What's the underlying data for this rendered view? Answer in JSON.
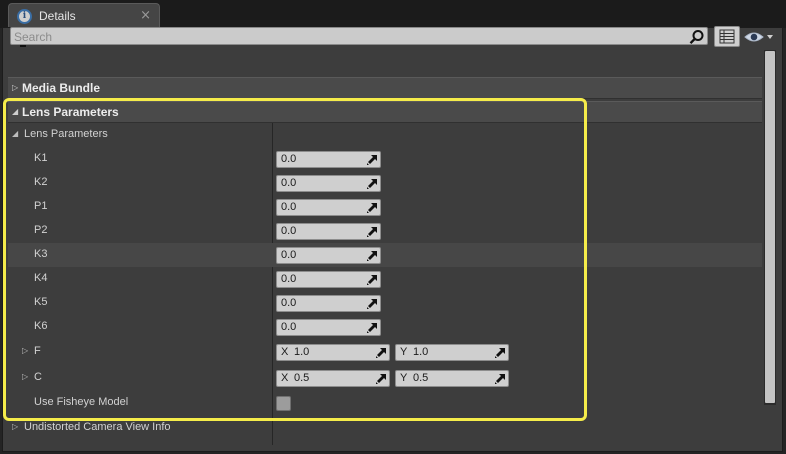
{
  "tab": {
    "title": "Details",
    "icon": "info-icon",
    "close": "×"
  },
  "toolbar": {
    "search_placeholder": "Search",
    "view_options_icon": "eye-icon",
    "grid_icon": "property-matrix-icon"
  },
  "categories": {
    "media_bundle": "Media Bundle",
    "lens_parameters": "Lens Parameters"
  },
  "lens": {
    "group_label": "Lens Parameters",
    "rows": [
      {
        "label": "K1",
        "value": "0.0"
      },
      {
        "label": "K2",
        "value": "0.0"
      },
      {
        "label": "P1",
        "value": "0.0"
      },
      {
        "label": "P2",
        "value": "0.0"
      },
      {
        "label": "K3",
        "value": "0.0"
      },
      {
        "label": "K4",
        "value": "0.0"
      },
      {
        "label": "K5",
        "value": "0.0"
      },
      {
        "label": "K6",
        "value": "0.0"
      }
    ],
    "f": {
      "label": "F",
      "x_axis": "X",
      "x": "1.0",
      "y_axis": "Y",
      "y": "1.0"
    },
    "c": {
      "label": "C",
      "x_axis": "X",
      "x": "0.5",
      "y_axis": "Y",
      "y": "0.5"
    },
    "fisheye": {
      "label": "Use Fisheye Model",
      "checked": false
    }
  },
  "undistorted": {
    "label": "Undistorted Camera View Info"
  },
  "colors": {
    "highlight": "#f5ec4a",
    "panel": "#3d3d3d",
    "field": "#cfcfcf"
  }
}
